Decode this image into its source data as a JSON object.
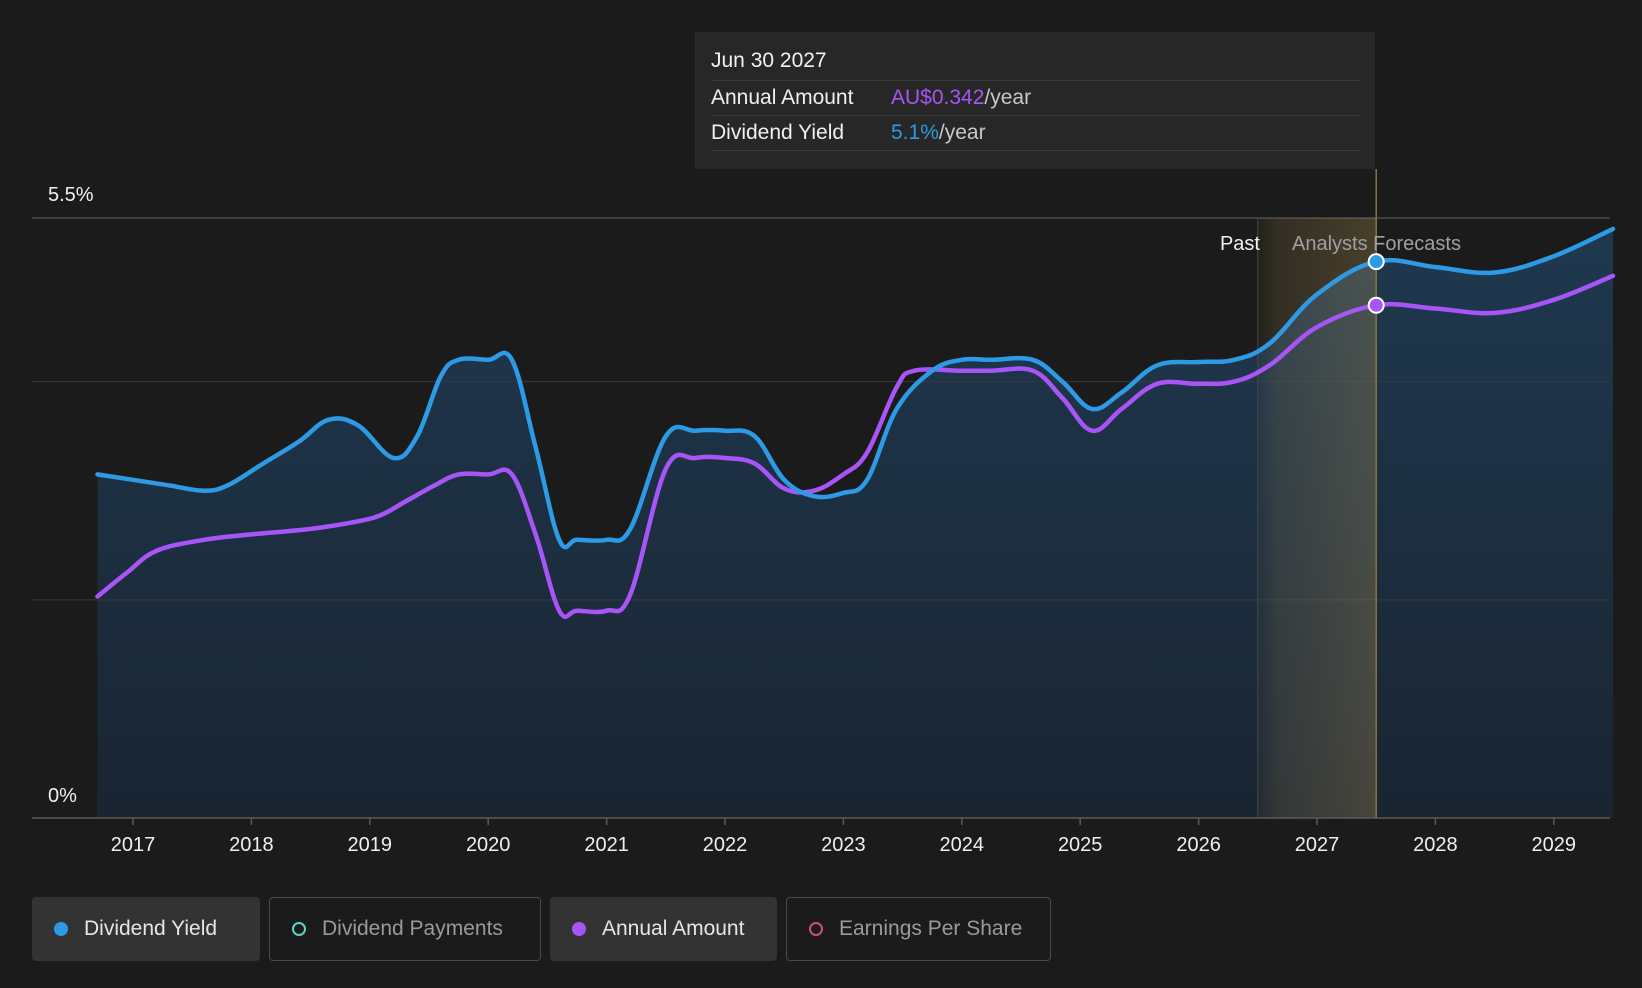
{
  "tooltip": {
    "date": "Jun 30 2027",
    "rows": [
      {
        "label": "Annual Amount",
        "value": "AU$0.342",
        "unit": "/year",
        "color": "#a855f7"
      },
      {
        "label": "Dividend Yield",
        "value": "5.1%",
        "unit": "/year",
        "color": "#2d9ae6"
      }
    ]
  },
  "legend": [
    {
      "label": "Dividend Yield",
      "color": "#2d9ae6",
      "active": true,
      "filled": true
    },
    {
      "label": "Dividend Payments",
      "color": "#5ad6c0",
      "active": false,
      "filled": false
    },
    {
      "label": "Annual Amount",
      "color": "#a855f7",
      "active": true,
      "filled": true
    },
    {
      "label": "Earnings Per Share",
      "color": "#d04a8a",
      "active": false,
      "filled": false
    }
  ],
  "chart_data": {
    "type": "line",
    "y_tick_labels": [
      "5.5%",
      "0%"
    ],
    "ylim": [
      0,
      5.5
    ],
    "x_ticks": [
      "2017",
      "2018",
      "2019",
      "2020",
      "2021",
      "2022",
      "2023",
      "2024",
      "2025",
      "2026",
      "2027",
      "2028",
      "2029"
    ],
    "region_labels": {
      "past": "Past",
      "forecast": "Analysts Forecasts"
    },
    "region_boundary": 2026.5,
    "highlight_x": 2027.5,
    "series": [
      {
        "name": "Dividend Yield",
        "color": "#2d9ae6",
        "points": [
          [
            2016.7,
            3.15
          ],
          [
            2017.0,
            3.1
          ],
          [
            2017.3,
            3.05
          ],
          [
            2017.6,
            3.0
          ],
          [
            2017.8,
            3.05
          ],
          [
            2018.1,
            3.25
          ],
          [
            2018.4,
            3.45
          ],
          [
            2018.65,
            3.65
          ],
          [
            2018.9,
            3.6
          ],
          [
            2019.2,
            3.3
          ],
          [
            2019.4,
            3.5
          ],
          [
            2019.6,
            4.05
          ],
          [
            2019.75,
            4.2
          ],
          [
            2020.0,
            4.2
          ],
          [
            2020.2,
            4.2
          ],
          [
            2020.4,
            3.4
          ],
          [
            2020.6,
            2.55
          ],
          [
            2020.75,
            2.55
          ],
          [
            2021.0,
            2.55
          ],
          [
            2021.2,
            2.65
          ],
          [
            2021.5,
            3.5
          ],
          [
            2021.75,
            3.55
          ],
          [
            2022.0,
            3.55
          ],
          [
            2022.25,
            3.5
          ],
          [
            2022.5,
            3.1
          ],
          [
            2022.75,
            2.95
          ],
          [
            2023.0,
            2.98
          ],
          [
            2023.2,
            3.1
          ],
          [
            2023.45,
            3.75
          ],
          [
            2023.75,
            4.1
          ],
          [
            2024.0,
            4.2
          ],
          [
            2024.25,
            4.2
          ],
          [
            2024.6,
            4.2
          ],
          [
            2024.85,
            4.0
          ],
          [
            2025.1,
            3.75
          ],
          [
            2025.35,
            3.9
          ],
          [
            2025.65,
            4.15
          ],
          [
            2026.0,
            4.18
          ],
          [
            2026.3,
            4.2
          ],
          [
            2026.6,
            4.35
          ],
          [
            2027.0,
            4.8
          ],
          [
            2027.5,
            5.1
          ],
          [
            2028.0,
            5.05
          ],
          [
            2028.5,
            5.0
          ],
          [
            2029.0,
            5.15
          ],
          [
            2029.5,
            5.4
          ]
        ]
      },
      {
        "name": "Annual Amount",
        "color": "#a855f7",
        "points": [
          [
            2016.7,
            2.03
          ],
          [
            2016.95,
            2.25
          ],
          [
            2017.2,
            2.45
          ],
          [
            2017.6,
            2.55
          ],
          [
            2018.0,
            2.6
          ],
          [
            2018.5,
            2.65
          ],
          [
            2018.9,
            2.72
          ],
          [
            2019.1,
            2.78
          ],
          [
            2019.3,
            2.9
          ],
          [
            2019.55,
            3.05
          ],
          [
            2019.75,
            3.15
          ],
          [
            2020.0,
            3.15
          ],
          [
            2020.2,
            3.15
          ],
          [
            2020.4,
            2.6
          ],
          [
            2020.6,
            1.9
          ],
          [
            2020.75,
            1.9
          ],
          [
            2021.0,
            1.9
          ],
          [
            2021.2,
            2.05
          ],
          [
            2021.5,
            3.2
          ],
          [
            2021.75,
            3.3
          ],
          [
            2022.0,
            3.3
          ],
          [
            2022.25,
            3.25
          ],
          [
            2022.5,
            3.02
          ],
          [
            2022.75,
            3.0
          ],
          [
            2023.0,
            3.15
          ],
          [
            2023.2,
            3.35
          ],
          [
            2023.45,
            3.95
          ],
          [
            2023.6,
            4.1
          ],
          [
            2024.0,
            4.1
          ],
          [
            2024.25,
            4.1
          ],
          [
            2024.6,
            4.1
          ],
          [
            2024.85,
            3.85
          ],
          [
            2025.1,
            3.55
          ],
          [
            2025.35,
            3.75
          ],
          [
            2025.65,
            3.98
          ],
          [
            2026.0,
            3.98
          ],
          [
            2026.3,
            4.0
          ],
          [
            2026.6,
            4.15
          ],
          [
            2027.0,
            4.5
          ],
          [
            2027.5,
            4.7
          ],
          [
            2028.0,
            4.67
          ],
          [
            2028.5,
            4.63
          ],
          [
            2029.0,
            4.75
          ],
          [
            2029.5,
            4.97
          ]
        ]
      }
    ]
  }
}
